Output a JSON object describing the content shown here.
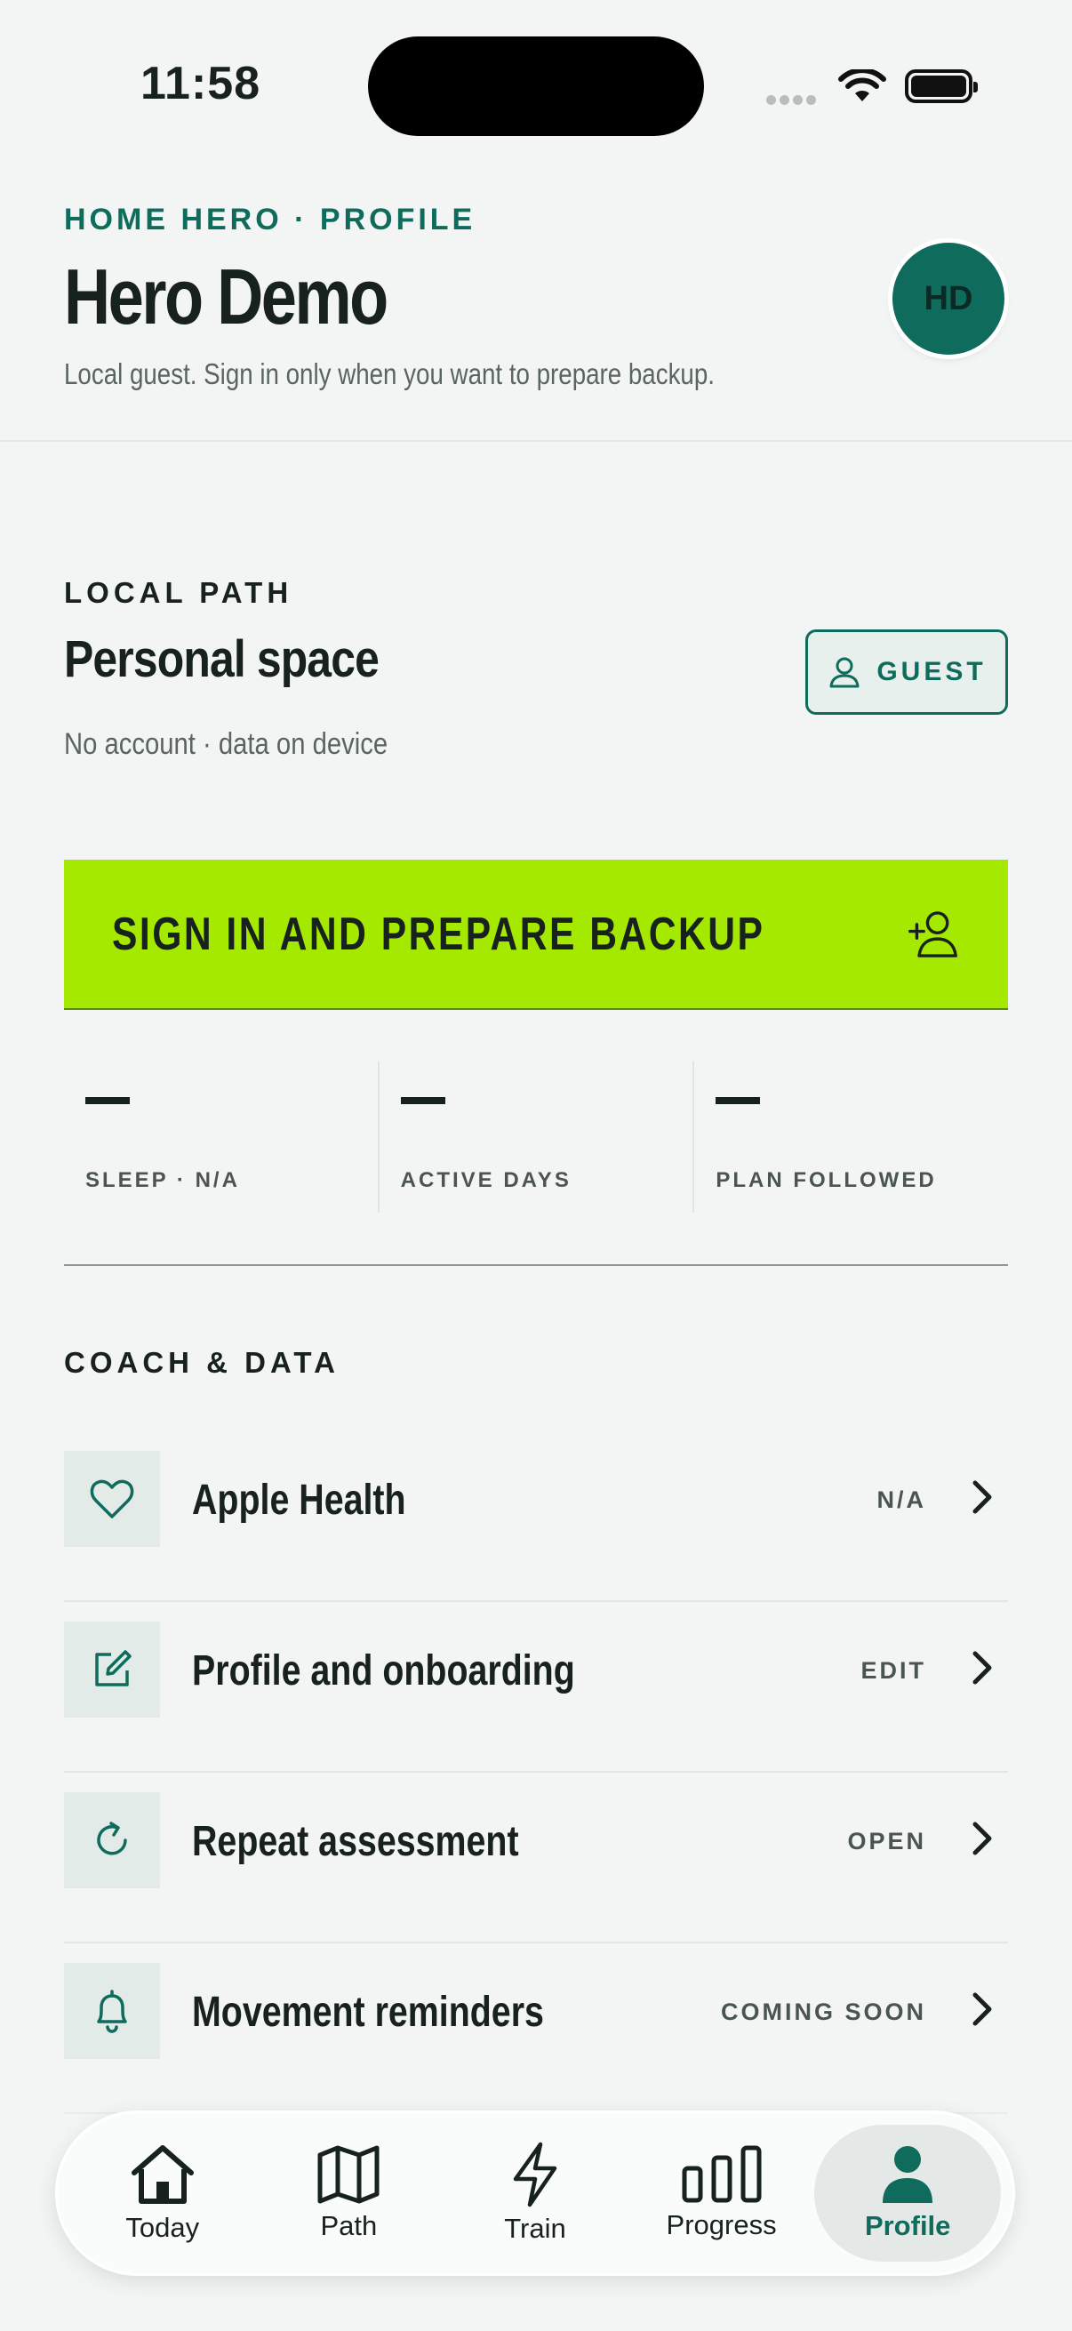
{
  "status_bar": {
    "time": "11:58"
  },
  "header": {
    "eyebrow": "HOME HERO · PROFILE",
    "title": "Hero Demo",
    "subtitle": "Local guest. Sign in only when you want to prepare backup.",
    "avatar_initials": "HD"
  },
  "local_path": {
    "label": "LOCAL PATH",
    "title": "Personal space",
    "subtitle": "No account · data on device",
    "badge": "GUEST"
  },
  "cta": {
    "label": "SIGN IN AND PREPARE BACKUP",
    "icon": "person-add-icon"
  },
  "stats": [
    {
      "value": "—",
      "label": "SLEEP · N/A"
    },
    {
      "value": "—",
      "label": "ACTIVE DAYS"
    },
    {
      "value": "—",
      "label": "PLAN FOLLOWED"
    }
  ],
  "coach_data": {
    "label": "COACH & DATA",
    "items": [
      {
        "icon": "heart-icon",
        "title": "Apple Health",
        "status": "N/A"
      },
      {
        "icon": "edit-icon",
        "title": "Profile and onboarding",
        "status": "EDIT"
      },
      {
        "icon": "refresh-icon",
        "title": "Repeat assessment",
        "status": "OPEN"
      },
      {
        "icon": "bell-icon",
        "title": "Movement reminders",
        "status": "COMING SOON"
      }
    ]
  },
  "tabbar": {
    "tabs": [
      {
        "label": "Today",
        "icon": "home-icon"
      },
      {
        "label": "Path",
        "icon": "map-icon"
      },
      {
        "label": "Train",
        "icon": "bolt-icon"
      },
      {
        "label": "Progress",
        "icon": "bar-chart-icon"
      },
      {
        "label": "Profile",
        "icon": "person-icon"
      }
    ],
    "active": "Profile"
  },
  "colors": {
    "accent": "#0f6b5c",
    "cta": "#a5e800",
    "background": "#f3f5f4",
    "text": "#17211d"
  }
}
